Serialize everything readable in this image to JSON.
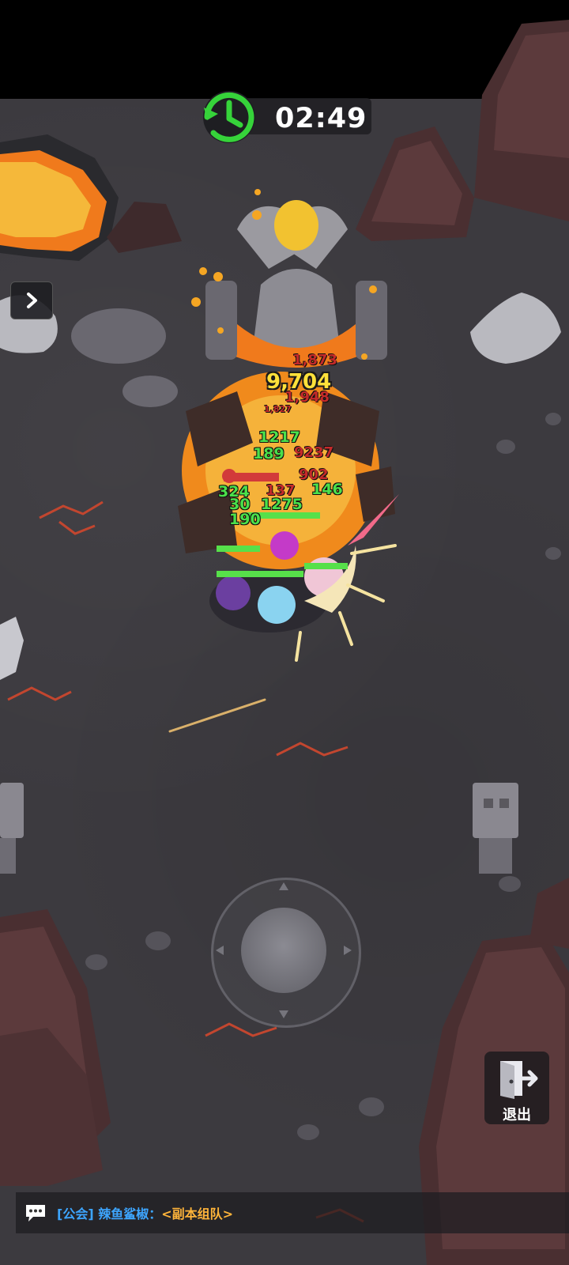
{
  "hud": {
    "timer": "02:49",
    "timer_icon": "clock-restore-icon",
    "expand_icon": "chevron-right-icon",
    "exit_label": "退出",
    "exit_icon": "exit-door-icon"
  },
  "chat": {
    "icon": "chat-bubble-icon",
    "channel": "[公会]",
    "user": "辣鱼鲨椒",
    "separator": "：",
    "message": "<副本组队>"
  },
  "damage_numbers": {
    "big": "9,704",
    "red_top": "1,873",
    "red_1948": "1,948",
    "red_1827": "1,827",
    "green_1217": "1217",
    "green_189": "189",
    "red_237": "9237",
    "green_146": "146",
    "green_324": "324",
    "red_137": "137",
    "green_30": "30",
    "green_1275": "1275",
    "green_190": "190",
    "red_902": "902"
  },
  "colors": {
    "ground": "#3c3a3f",
    "lava": "#f5a623",
    "timer_green": "#36d33a",
    "health_green": "#57e04a",
    "boss_health_red": "#d23a3a"
  }
}
